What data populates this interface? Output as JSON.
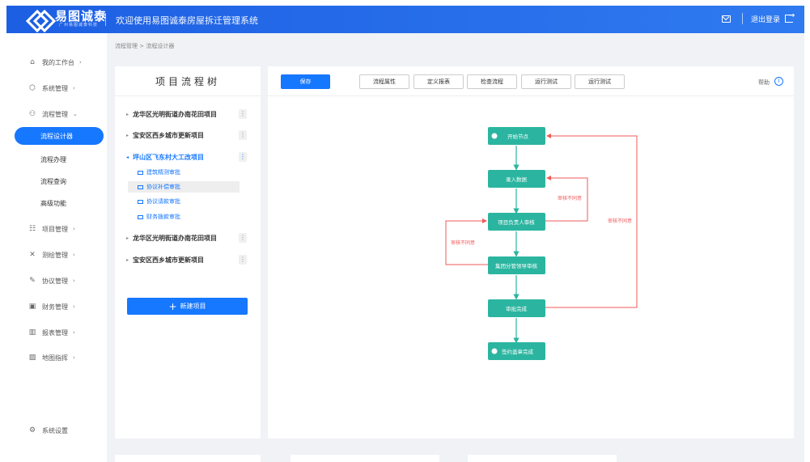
{
  "header": {
    "logo_text": "易图诚泰",
    "logo_sub": "广州易图诚泰科技",
    "welcome": "欢迎使用易图诚泰房屋拆迁管理系统",
    "logout": "退出登录"
  },
  "sidebar": {
    "workbench": "我的工作台",
    "system": "系统管理",
    "process": "流程管理",
    "designer": "流程设计器",
    "handle": "流程办理",
    "query": "流程查询",
    "advanced": "高级功能",
    "project": "项目管理",
    "survey": "测绘管理",
    "agreement": "协议管理",
    "finance": "财务管理",
    "report": "报表管理",
    "map": "地图指挥",
    "settings": "系统设置"
  },
  "breadcrumb": "流程管理 > 流程设计器",
  "tree": {
    "title": "项目流程树",
    "projects": [
      "龙华区光明街道办南花田项目",
      "宝安区西乡城市更新项目",
      "坪山区飞东村大工改项目",
      "龙华区光明街道办南花田项目",
      "宝安区西乡城市更新项目"
    ],
    "leaves": [
      "建筑精测审批",
      "协议补偿审批",
      "协议请款审批",
      "财务拨款审批"
    ],
    "new_button": "新建项目",
    "plus": "+"
  },
  "toolbar": {
    "save": "保存",
    "buttons": [
      "流程属性",
      "定义报表",
      "检查流程",
      "运行测试",
      "运行测试"
    ],
    "help": "帮助",
    "help_icon": "i"
  },
  "flow": {
    "nodes": [
      "开始节点",
      "录入数据",
      "项目负责人审核",
      "集团分管领导审核",
      "审批完成",
      "签约盖章完成"
    ],
    "reject_labels": [
      "审核不同意",
      "审核不同意",
      "审核不同意"
    ],
    "node_color": "#2bb5a0",
    "reject_color": "#f05a5a"
  }
}
